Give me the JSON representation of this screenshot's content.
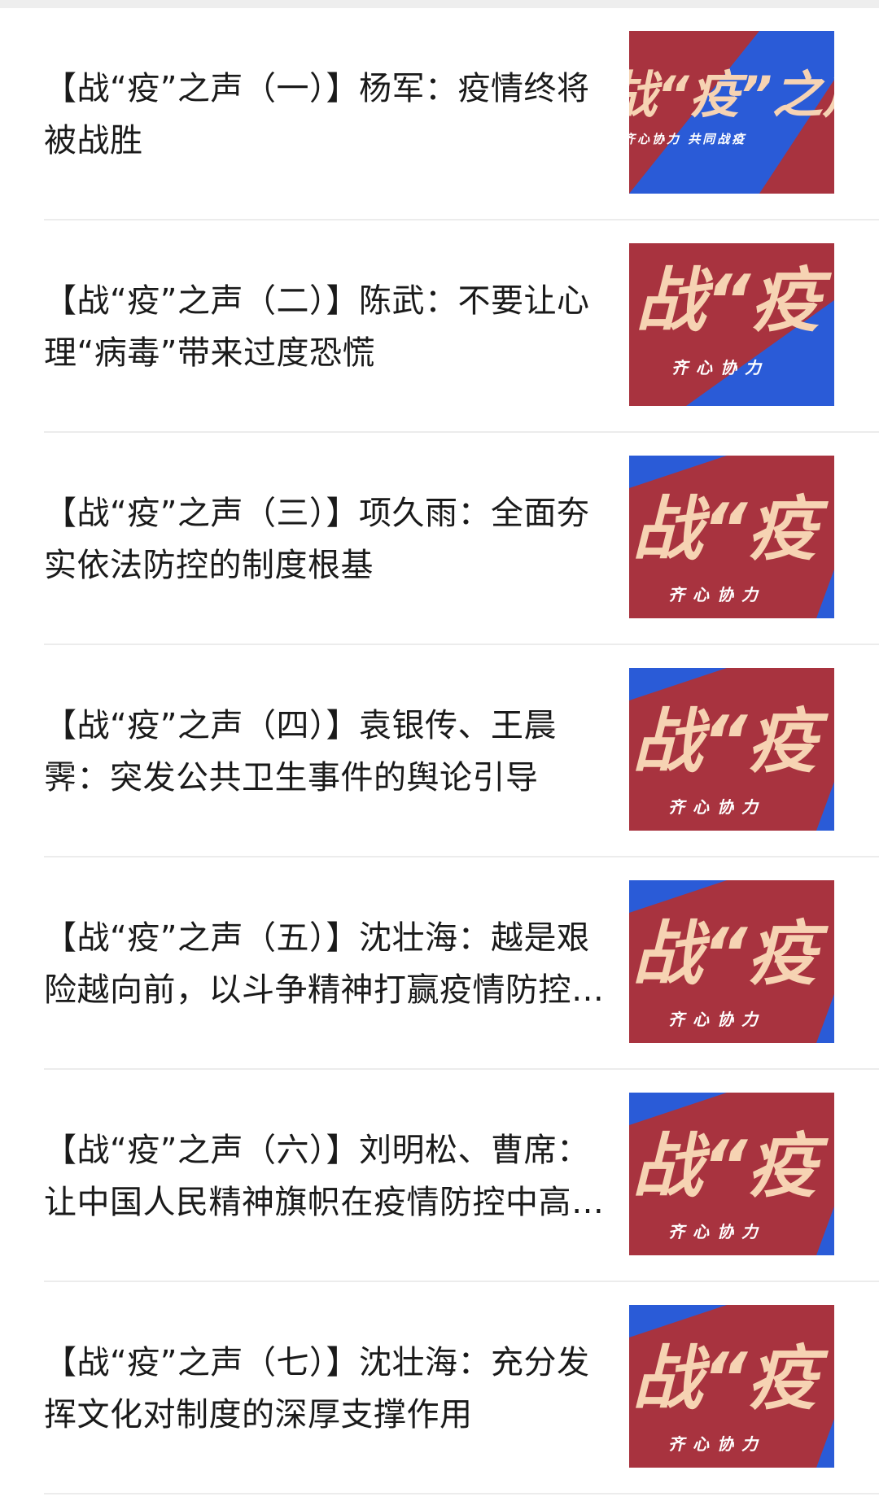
{
  "articles": [
    {
      "title": "【战“疫”之声（一）】杨军：疫情终将被战胜",
      "thumb": {
        "headline": "战“疫”之声",
        "tagline": "齐心协力    共同战疫",
        "variant": "wide"
      }
    },
    {
      "title": "【战“疫”之声（二）】陈武：不要让心理“病毒”带来过度恐慌",
      "thumb": {
        "headline": "战“疫",
        "tagline": "齐心协力",
        "variant": "zoom"
      }
    },
    {
      "title": "【战“疫”之声（三）】项久雨：全面夯实依法防控的制度根基",
      "thumb": {
        "headline": "战“疫",
        "tagline": "齐心协力",
        "variant": "zoom"
      }
    },
    {
      "title": "【战“疫”之声（四）】袁银传、王晨霁：突发公共卫生事件的舆论引导",
      "thumb": {
        "headline": "战“疫",
        "tagline": "齐心协力",
        "variant": "zoom"
      }
    },
    {
      "title": "【战“疫”之声（五）】沈壮海：越是艰险越向前，以斗争精神打赢疫情防控阻击战",
      "thumb": {
        "headline": "战“疫",
        "tagline": "齐心协力",
        "variant": "zoom"
      }
    },
    {
      "title": "【战“疫”之声（六）】刘明松、曹席：让中国人民精神旗帜在疫情防控中高高飘扬",
      "thumb": {
        "headline": "战“疫",
        "tagline": "齐心协力",
        "variant": "zoom"
      }
    },
    {
      "title": "【战“疫”之声（七）】沈壮海：充分发挥文化对制度的深厚支撑作用",
      "thumb": {
        "headline": "战“疫",
        "tagline": "齐心协力",
        "variant": "zoom"
      }
    }
  ],
  "colors": {
    "blue": "#2a5bd7",
    "red": "#a8333f",
    "headline": "#f6d3b3",
    "tagline": "#ffffff"
  }
}
